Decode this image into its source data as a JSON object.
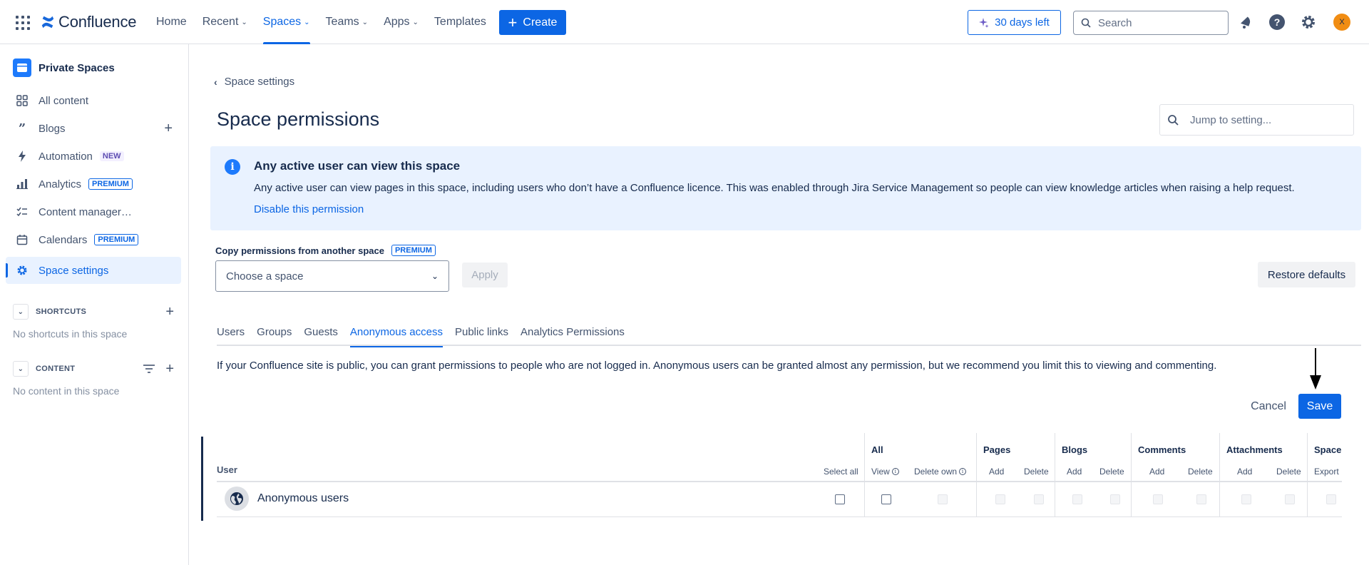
{
  "nav": {
    "logo_text": "Confluence",
    "items": [
      {
        "label": "Home",
        "dropdown": false
      },
      {
        "label": "Recent",
        "dropdown": true
      },
      {
        "label": "Spaces",
        "dropdown": true,
        "active": true
      },
      {
        "label": "Teams",
        "dropdown": true
      },
      {
        "label": "Apps",
        "dropdown": true
      },
      {
        "label": "Templates",
        "dropdown": false
      }
    ],
    "create_label": "Create",
    "trial_label": "30 days left",
    "search_placeholder": "Search",
    "avatar_initial": "X",
    "accent": "#0c66e4",
    "avatar_color": "#f18d13"
  },
  "sidebar": {
    "space_name": "Private Spaces",
    "items": [
      {
        "label": "All content",
        "icon": "grid-icon"
      },
      {
        "label": "Blogs",
        "icon": "quote-icon",
        "add": true
      },
      {
        "label": "Automation",
        "icon": "lightning-icon",
        "badge": "NEW"
      },
      {
        "label": "Analytics",
        "icon": "bar-chart-icon",
        "badge": "PREMIUM"
      },
      {
        "label": "Content manager…",
        "icon": "checklist-icon"
      },
      {
        "label": "Calendars",
        "icon": "calendar-icon",
        "badge": "PREMIUM"
      },
      {
        "label": "Space settings",
        "icon": "gear-icon",
        "active": true
      }
    ],
    "shortcuts": {
      "title": "SHORTCUTS",
      "empty": "No shortcuts in this space"
    },
    "content": {
      "title": "CONTENT",
      "empty": "No content in this space"
    }
  },
  "main": {
    "back_label": "Space settings",
    "title": "Space permissions",
    "jump_placeholder": "Jump to setting...",
    "info": {
      "title": "Any active user can view this space",
      "body": "Any active user can view pages in this space, including users who don’t have a Confluence licence. This was enabled through Jira Service Management so people can view knowledge articles when raising a help request.",
      "link": "Disable this permission"
    },
    "copy": {
      "label": "Copy permissions from another space",
      "badge": "PREMIUM",
      "select_placeholder": "Choose a space",
      "apply_label": "Apply"
    },
    "restore_label": "Restore defaults",
    "tabs": [
      "Users",
      "Groups",
      "Guests",
      "Anonymous access",
      "Public links",
      "Analytics Permissions"
    ],
    "active_tab": "Anonymous access",
    "description": "If your Confluence site is public, you can grant permissions to people who are not logged in. Anonymous users can be granted almost any permission, but we recommend you limit this to viewing and commenting.",
    "cancel_label": "Cancel",
    "save_label": "Save"
  },
  "table": {
    "user_header": "User",
    "select_all": "Select all",
    "groups": [
      {
        "name": "All",
        "subs": [
          "View",
          "Delete own"
        ]
      },
      {
        "name": "Pages",
        "subs": [
          "Add",
          "Delete"
        ]
      },
      {
        "name": "Blogs",
        "subs": [
          "Add",
          "Delete"
        ]
      },
      {
        "name": "Comments",
        "subs": [
          "Add",
          "Delete"
        ]
      },
      {
        "name": "Attachments",
        "subs": [
          "Add",
          "Delete"
        ]
      },
      {
        "name": "Space",
        "subs": [
          "Export"
        ]
      }
    ],
    "rows": [
      {
        "user": "Anonymous users",
        "select_all": false,
        "view": false
      }
    ]
  }
}
